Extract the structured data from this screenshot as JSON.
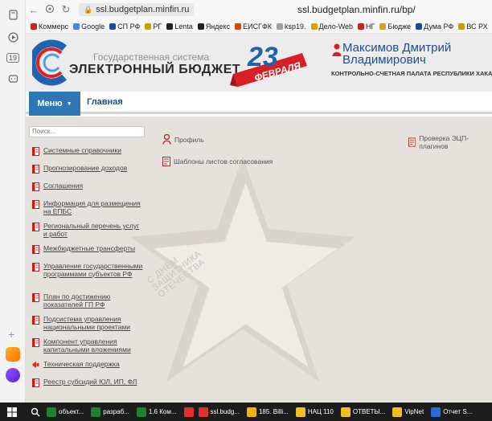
{
  "browser": {
    "url": "ssl.budgetplan.minfin.ru",
    "title": "ssl.budgetplan.minfin.ru/bp/",
    "bookmarks": [
      {
        "label": "Коммерс",
        "color": "#d02020"
      },
      {
        "label": "Google",
        "color": "#4285f4"
      },
      {
        "label": "СП РФ",
        "color": "#1a4aa8"
      },
      {
        "label": "РГ",
        "color": "#c8a000"
      },
      {
        "label": "Lenta",
        "color": "#222222"
      },
      {
        "label": "Яндекс",
        "color": "#222222"
      },
      {
        "label": "ЕИСГФК",
        "color": "#e04000"
      },
      {
        "label": "ksp19.",
        "color": "#9aa0a6"
      },
      {
        "label": "Дело-Web",
        "color": "#e0a000"
      },
      {
        "label": "НГ",
        "color": "#d02020"
      },
      {
        "label": "Бюдже",
        "color": "#d0a020"
      },
      {
        "label": "Дума РФ",
        "color": "#1a4aa8"
      },
      {
        "label": "ВС РХ",
        "color": "#c8a000"
      }
    ]
  },
  "sidepanel": {
    "calendar_day": "19"
  },
  "header": {
    "org_small": "Государственная система",
    "org_main": "ЭЛЕКТРОННЫЙ БЮДЖЕТ",
    "holiday_day": "23",
    "holiday_month": "ФЕВРАЛЯ",
    "user_name": "Максимов Дмитрий Владимирович",
    "user_org": "КОНТРОЛЬНО-СЧЕТНАЯ ПАЛАТА РЕСПУБЛИКИ ХАКАСИЯ"
  },
  "menubar": {
    "menu_label": "Меню",
    "main_label": "Главная"
  },
  "sidebar": {
    "search_placeholder": "Поиск...",
    "items": [
      {
        "label": "Системные справочники",
        "icon": "red-doc"
      },
      {
        "label": "Прогнозирование доходов",
        "icon": "red-doc"
      },
      {
        "label": "Соглашения",
        "icon": "red-doc"
      },
      {
        "label": "Информация для размещения на ЕПБС",
        "icon": "red-doc"
      },
      {
        "label": "Региональный перечень услуг и работ",
        "icon": "red-doc"
      },
      {
        "label": "Межбюджетные трансферты",
        "icon": "red-doc"
      },
      {
        "label": "Управление государственными программами субъектов РФ",
        "icon": "red-doc"
      },
      {
        "label": "План по достижению показателей ГП РФ",
        "icon": "red-doc"
      },
      {
        "label": "Подсистема управления национальными проектами",
        "icon": "red-doc"
      },
      {
        "label": "Компонент управления капитальными вложениями",
        "icon": "red-doc"
      },
      {
        "label": "Техническая поддержка",
        "icon": "megaphone"
      },
      {
        "label": "Реестр субсидий ЮЛ, ИП, ФЛ",
        "icon": "red-doc"
      }
    ]
  },
  "cards": {
    "profile": "Профиль",
    "templates": "Шаблоны листов согласования",
    "ecp_check": "Проверка ЭЦП-плагинов"
  },
  "background_text": {
    "line1": "С ДНЕМ",
    "line2": "ЗАЩИТНИКА",
    "line3": "ОТЕЧЕСТВА"
  },
  "taskbar": {
    "items": [
      {
        "label": "объект...",
        "color": "#1e7e34"
      },
      {
        "label": "разраб...",
        "color": "#1e7e34"
      },
      {
        "label": "1.6 Ком...",
        "color": "#1e7e34"
      },
      {
        "label": "",
        "color": "#e03030"
      },
      {
        "label": "ssl.budg...",
        "color": "#e03030"
      },
      {
        "label": "185. Billi...",
        "color": "#f0b400"
      },
      {
        "label": "НАЦ 110",
        "color": "#f0c020"
      },
      {
        "label": "ОТВЕТЫ...",
        "color": "#f0c020"
      },
      {
        "label": "VipNet",
        "color": "#f0c020"
      },
      {
        "label": "Отчет S...",
        "color": "#2b6bd4"
      }
    ]
  }
}
